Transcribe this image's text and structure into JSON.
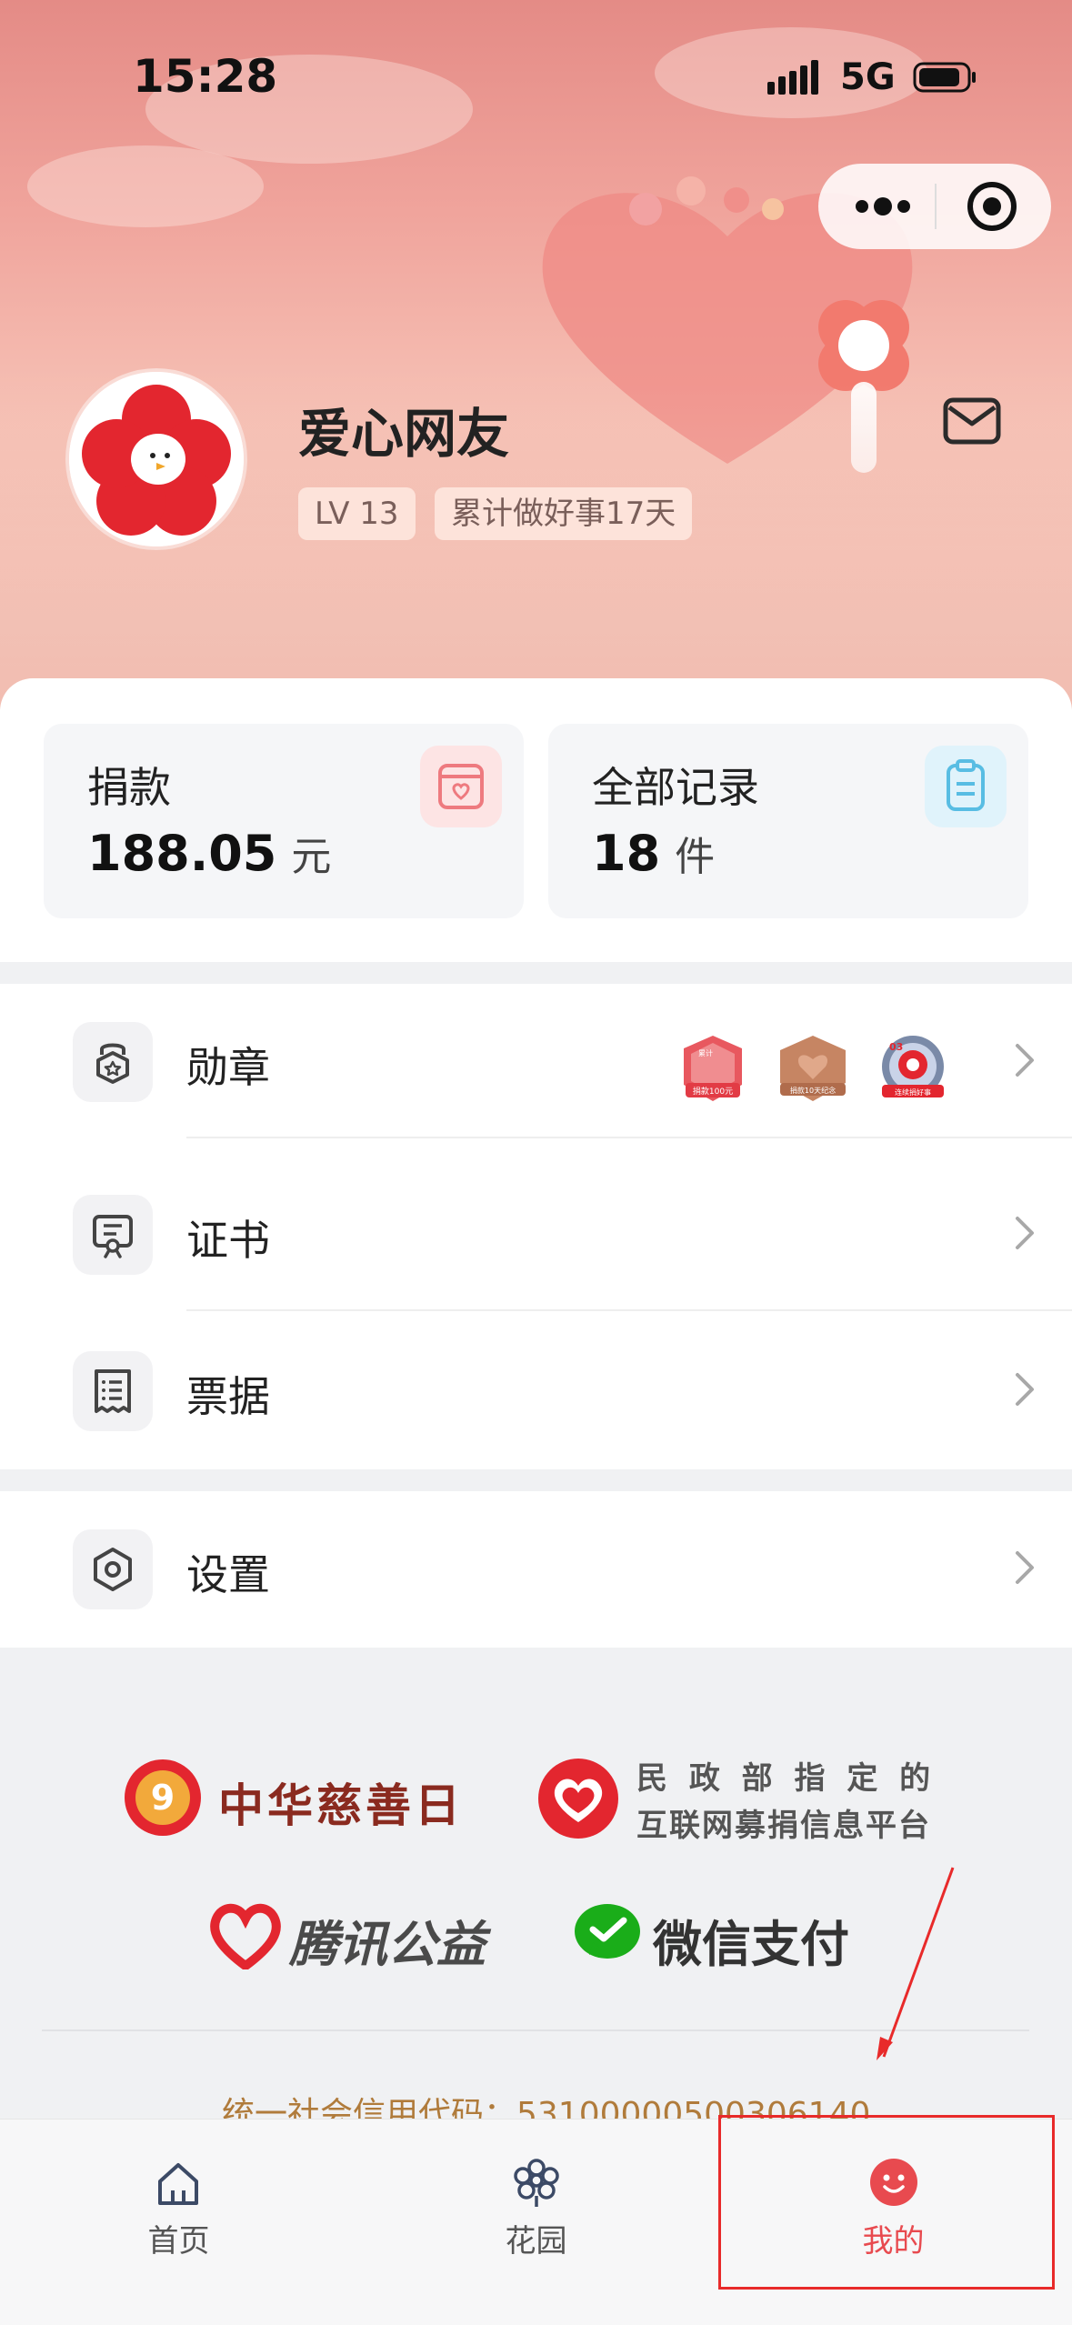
{
  "status_bar": {
    "time": "15:28",
    "network": "5G"
  },
  "profile": {
    "name": "爱心网友",
    "level": "LV 13",
    "good_deeds": "累计做好事17天"
  },
  "stats": [
    {
      "label": "捐款",
      "value": "188.05",
      "unit": "元"
    },
    {
      "label": "全部记录",
      "value": "18",
      "unit": "件"
    }
  ],
  "menu": {
    "medals": "勋章",
    "certificates": "证书",
    "receipts": "票据",
    "settings": "设置",
    "medal_badges": [
      {
        "top": "累计",
        "bottom": "捐款100元"
      },
      {
        "top": "",
        "bottom": "捐款10天纪念"
      },
      {
        "top": "03",
        "bottom": "连续捐好事"
      }
    ]
  },
  "footer": {
    "charity_day": "中华慈善日",
    "mca_line1": "民 政 部 指 定 的",
    "mca_line2": "互联网募捐信息平台",
    "tencent": "腾讯公益",
    "wechat_pay": "微信支付",
    "credit_code": "统一社会信用代码：53100000500306140"
  },
  "tabs": [
    {
      "label": "首页"
    },
    {
      "label": "花园"
    },
    {
      "label": "我的"
    }
  ],
  "colors": {
    "accent": "#e84a4f",
    "brand_red": "#e02b2b",
    "tab_inactive": "#555555",
    "credit": "#b07b3b"
  }
}
